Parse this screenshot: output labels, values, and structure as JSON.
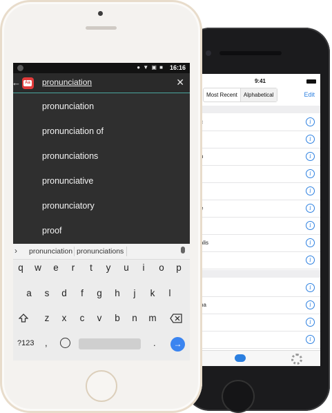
{
  "android": {
    "status_bar": {
      "icons": "● ▼ ▣ ■",
      "time": "16:16"
    },
    "search": {
      "back_glyph": "←",
      "app_icon_label": "Aa",
      "query": "pronunciation",
      "clear_glyph": "✕"
    },
    "suggestions": [
      "pronunciation",
      "pronunciation of",
      "pronunciations",
      "pronunciative",
      "pronunciatory",
      "proof"
    ],
    "keyboard": {
      "strip": {
        "chevron": "›",
        "suggestion_1": "pronunciation",
        "suggestion_2": "pronunciations"
      },
      "row1": [
        "q",
        "w",
        "e",
        "r",
        "t",
        "y",
        "u",
        "i",
        "o",
        "p"
      ],
      "row2": [
        "a",
        "s",
        "d",
        "f",
        "g",
        "h",
        "j",
        "k",
        "l"
      ],
      "row3": [
        "z",
        "x",
        "c",
        "v",
        "b",
        "n",
        "m"
      ],
      "bottom": {
        "symbols": "?123",
        "comma": ",",
        "period": ".",
        "enter_glyph": "→"
      }
    }
  },
  "ios": {
    "status_bar": {
      "time": "9:41"
    },
    "segments": [
      "Most Recent",
      "Alphabetical"
    ],
    "selected_segment": "Alphabetical",
    "edit_label": "Edit",
    "row_fragments": [
      "c",
      "n",
      "e",
      "alis",
      "na"
    ],
    "info_glyph": "i"
  },
  "colors": {
    "android_accent": "#4aa8a0",
    "app_icon_red": "#e23a3a",
    "ios_blue": "#2b7fe0",
    "enter_blue": "#3a84f0"
  }
}
